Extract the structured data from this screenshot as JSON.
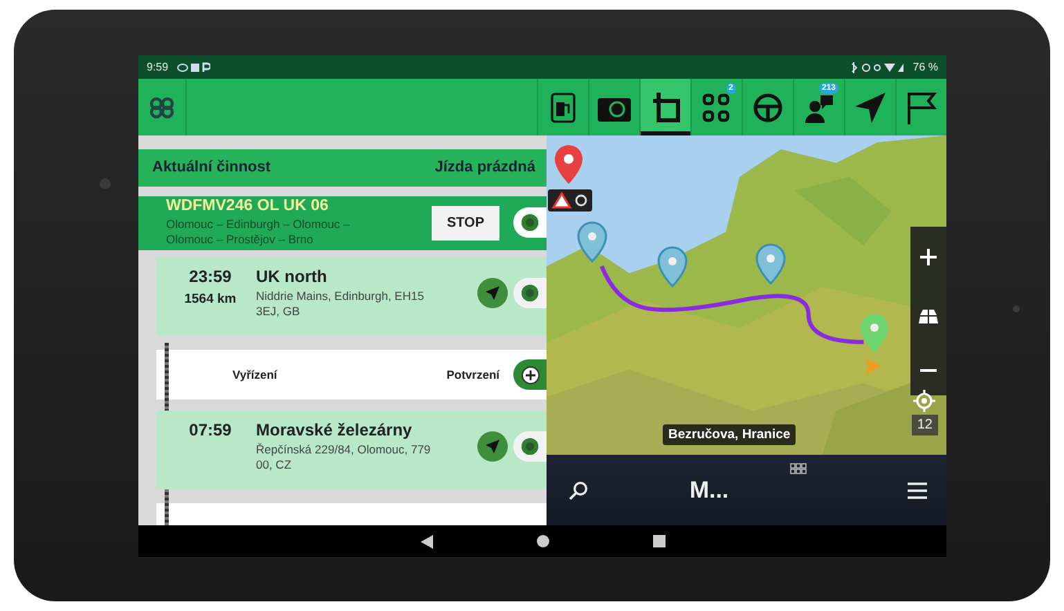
{
  "status_bar": {
    "time": "9:59",
    "battery": "76 %"
  },
  "toolbar": {
    "items": [
      {
        "kind": "fuel",
        "selected": false
      },
      {
        "kind": "camera",
        "selected": false
      },
      {
        "kind": "truck",
        "selected": true
      },
      {
        "kind": "grid",
        "selected": false,
        "badge": "2"
      },
      {
        "kind": "wheel",
        "selected": false
      },
      {
        "kind": "person",
        "selected": false,
        "badge": "213"
      },
      {
        "kind": "navigate",
        "selected": false
      },
      {
        "kind": "flag",
        "selected": false
      }
    ]
  },
  "activity": {
    "label": "Aktuální činnost",
    "value": "Jízda prázdná"
  },
  "trip": {
    "code": "WDFMV246 OL UK 06",
    "route": "Olomouc – Edinburgh – Olomouc – Olomouc – Prostějov – Brno",
    "button": "STOP"
  },
  "stops": [
    {
      "kind": "stop",
      "time": "23:59",
      "distance": "1564 km",
      "name": "UK north",
      "address": "Niddrie Mains, Edinburgh, EH15 3EJ, GB"
    },
    {
      "kind": "task",
      "label": "Vyřízení",
      "action": "Potvrzení"
    },
    {
      "kind": "stop",
      "time": "07:59",
      "name": "Moravské železárny",
      "address": "Řepčínská 229/84, Olomouc, 779 00, CZ"
    }
  ],
  "map": {
    "street": "Bezručova, Hranice",
    "zoom_level": "12",
    "destination": "M..."
  }
}
